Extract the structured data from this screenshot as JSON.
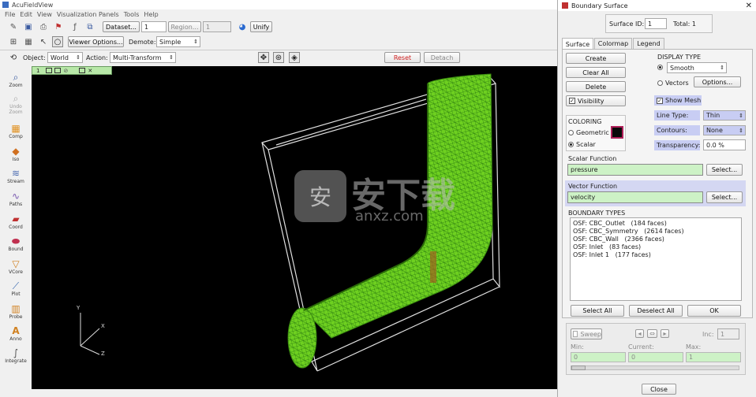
{
  "main_window": {
    "title": "AcuFieldView",
    "menu": [
      "File",
      "Edit",
      "View",
      "Visualization Panels",
      "Tools",
      "Help"
    ],
    "toolbar1": {
      "dataset_label": "Dataset...",
      "dataset_value": "1",
      "region_label": "Region...",
      "region_value": "1",
      "unify_label": "Unify"
    },
    "toolbar2": {
      "viewer_options_label": "Viewer Options...",
      "demote_label": "Demote:",
      "demote_value": "Simple"
    },
    "toolbar3": {
      "object_label": "Object:",
      "object_value": "World",
      "action_label": "Action:",
      "action_value": "Multi-Transform",
      "reset_label": "Reset",
      "detach_label": "Detach"
    },
    "viewport_tab": "1",
    "axes": {
      "x": "X",
      "y": "Y",
      "z": "Z"
    },
    "sidebar": [
      {
        "label": "Zoom",
        "icon": "zoom-icon"
      },
      {
        "label": "Undo Zoom",
        "icon": "undo-zoom-icon"
      },
      {
        "label": "Comp",
        "icon": "comp-icon"
      },
      {
        "label": "Iso",
        "icon": "iso-icon"
      },
      {
        "label": "Stream",
        "icon": "stream-icon"
      },
      {
        "label": "Paths",
        "icon": "paths-icon"
      },
      {
        "label": "Coord",
        "icon": "coord-icon"
      },
      {
        "label": "Bound",
        "icon": "bound-icon"
      },
      {
        "label": "VCore",
        "icon": "vcore-icon"
      },
      {
        "label": "Plot",
        "icon": "plot-icon"
      },
      {
        "label": "Probe",
        "icon": "probe-icon"
      },
      {
        "label": "Anno",
        "icon": "anno-icon"
      },
      {
        "label": "Integrate",
        "icon": "integrate-icon"
      }
    ]
  },
  "watermark": {
    "cn": "安下载",
    "en": "anxz.com"
  },
  "panel": {
    "title": "Boundary Surface",
    "surface_id_label": "Surface ID:",
    "surface_id_value": "1",
    "total_label": "Total: 1",
    "tabs": [
      "Surface",
      "Colormap",
      "Legend"
    ],
    "create_label": "Create",
    "clear_all_label": "Clear All",
    "delete_label": "Delete",
    "visibility_label": "Visibility",
    "display_type_label": "DISPLAY TYPE",
    "smooth_label": "Smooth",
    "vectors_label": "Vectors",
    "options_label": "Options...",
    "show_mesh_label": "Show Mesh",
    "line_type_label": "Line Type:",
    "line_type_value": "Thin",
    "contours_label": "Contours:",
    "contours_value": "None",
    "transparency_label": "Transparency:",
    "transparency_value": "0.0 %",
    "coloring_label": "COLORING",
    "geometric_label": "Geometric",
    "scalar_label": "Scalar",
    "scalar_function_label": "Scalar Function",
    "scalar_function_value": "pressure",
    "select_label": "Select...",
    "vector_function_label": "Vector Function",
    "vector_function_value": "velocity",
    "boundary_types_label": "BOUNDARY TYPES",
    "boundary_types": [
      {
        "name": "OSF: CBC_Outlet",
        "faces": "(184 faces)"
      },
      {
        "name": "OSF: CBC_Symmetry",
        "faces": "(2614 faces)"
      },
      {
        "name": "OSF: CBC_Wall",
        "faces": "(2366 faces)"
      },
      {
        "name": "OSF: Inlet",
        "faces": "(83 faces)"
      },
      {
        "name": "OSF: Inlet 1",
        "faces": "(177 faces)"
      }
    ],
    "select_all_label": "Select All",
    "deselect_all_label": "Deselect All",
    "ok_label": "OK",
    "sweep_label": "Sweep",
    "inc_label": "Inc:",
    "inc_value": "1",
    "min_label": "Min:",
    "min_value": "0",
    "current_label": "Current:",
    "current_value": "0",
    "max_label": "Max:",
    "max_value": "1",
    "close_label": "Close"
  }
}
